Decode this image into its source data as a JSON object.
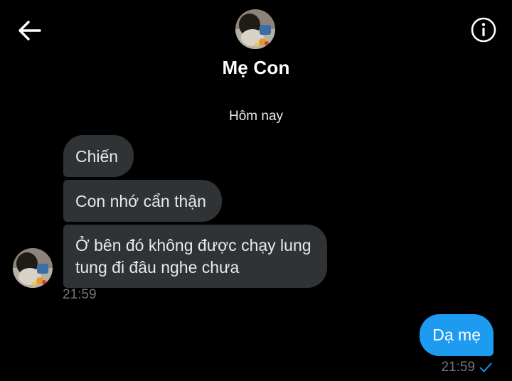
{
  "header": {
    "contact_name": "Mẹ Con",
    "back_icon": "arrow-left-icon",
    "info_icon": "info-circle-icon"
  },
  "conversation": {
    "date_separator": "Hôm nay",
    "incoming": {
      "messages": [
        {
          "text": "Chiến"
        },
        {
          "text": "Con nhớ cẩn thận"
        },
        {
          "text_line1": "Ở bên đó không được chạy lung",
          "text_line2": "tung đi đâu nghe chưa"
        }
      ],
      "timestamp": "21:59"
    },
    "outgoing": {
      "messages": [
        {
          "text": "Dạ mẹ"
        }
      ],
      "timestamp": "21:59",
      "status_icon": "sent-check-icon"
    }
  },
  "colors": {
    "background": "#000000",
    "incoming_bubble": "#2f3336",
    "outgoing_bubble": "#1d9bf0",
    "muted_text": "#71767b",
    "check_color": "#1d9bf0"
  }
}
